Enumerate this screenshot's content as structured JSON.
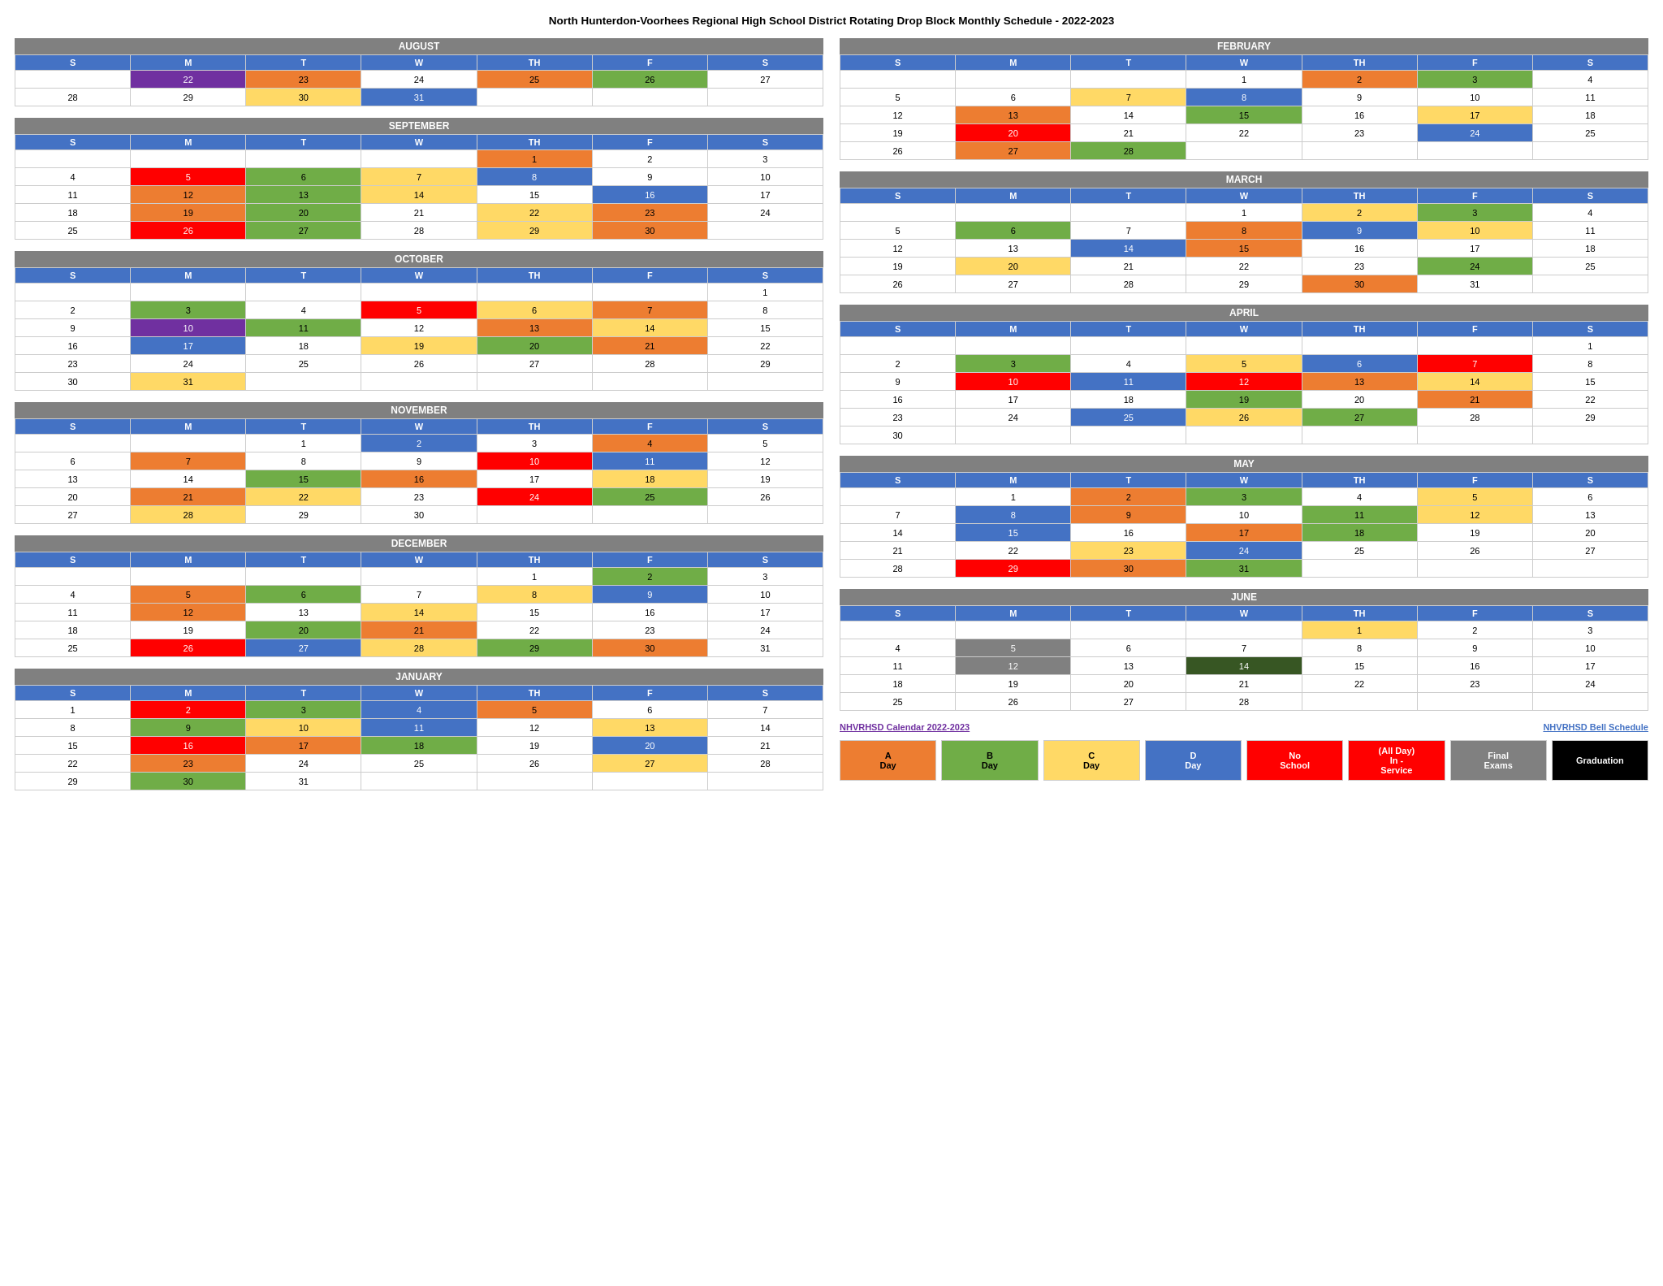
{
  "title": "North Hunterdon-Voorhees Regional High School District Rotating Drop Block Monthly Schedule - 2022-2023",
  "months": {
    "august": {
      "name": "AUGUST",
      "headers": [
        "S",
        "M",
        "T",
        "W",
        "TH",
        "F",
        "S"
      ],
      "rows": [
        [
          "",
          "22",
          "23",
          "24",
          "25",
          "26",
          "27"
        ],
        [
          "28",
          "29",
          "30",
          "31",
          "",
          "",
          ""
        ]
      ],
      "colors": {
        "22": "bg-purple",
        "23": "bg-a",
        "25": "bg-a",
        "26": "bg-b",
        "29": "",
        "30": "bg-c",
        "31": "bg-d"
      }
    },
    "september": {
      "name": "SEPTEMBER",
      "headers": [
        "S",
        "M",
        "T",
        "W",
        "TH",
        "F",
        "S"
      ],
      "rows": [
        [
          "",
          "",
          "",
          "",
          "1",
          "2",
          "3"
        ],
        [
          "4",
          "5",
          "6",
          "7",
          "8",
          "9",
          "10"
        ],
        [
          "11",
          "12",
          "13",
          "14",
          "15",
          "16",
          "17"
        ],
        [
          "18",
          "19",
          "20",
          "21",
          "22",
          "23",
          "24"
        ],
        [
          "25",
          "26",
          "27",
          "28",
          "29",
          "30",
          ""
        ]
      ]
    },
    "october": {
      "name": "OCTOBER",
      "headers": [
        "S",
        "M",
        "T",
        "W",
        "TH",
        "F",
        "S"
      ],
      "rows": [
        [
          "",
          "",
          "",
          "",
          "",
          "",
          "1"
        ],
        [
          "2",
          "3",
          "4",
          "5",
          "6",
          "7",
          "8"
        ],
        [
          "9",
          "10",
          "11",
          "12",
          "13",
          "14",
          "15"
        ],
        [
          "16",
          "17",
          "18",
          "19",
          "20",
          "21",
          "22"
        ],
        [
          "23",
          "24",
          "25",
          "26",
          "27",
          "28",
          "29"
        ],
        [
          "30",
          "31",
          "",
          "",
          "",
          "",
          ""
        ]
      ]
    },
    "november": {
      "name": "NOVEMBER",
      "headers": [
        "S",
        "M",
        "T",
        "W",
        "TH",
        "F",
        "S"
      ],
      "rows": [
        [
          "",
          "",
          "1",
          "2",
          "3",
          "4",
          "5"
        ],
        [
          "6",
          "7",
          "8",
          "9",
          "10",
          "11",
          "12"
        ],
        [
          "13",
          "14",
          "15",
          "16",
          "17",
          "18",
          "19"
        ],
        [
          "20",
          "21",
          "22",
          "23",
          "24",
          "25",
          "26"
        ],
        [
          "27",
          "28",
          "29",
          "30",
          "",
          "",
          ""
        ]
      ]
    },
    "december": {
      "name": "DECEMBER",
      "headers": [
        "S",
        "M",
        "T",
        "W",
        "TH",
        "F",
        "S"
      ],
      "rows": [
        [
          "",
          "",
          "",
          "",
          "1",
          "2",
          "3"
        ],
        [
          "4",
          "5",
          "6",
          "7",
          "8",
          "9",
          "10"
        ],
        [
          "11",
          "12",
          "13",
          "14",
          "15",
          "16",
          "17"
        ],
        [
          "18",
          "19",
          "20",
          "21",
          "22",
          "23",
          "24"
        ],
        [
          "25",
          "26",
          "27",
          "28",
          "29",
          "30",
          "31"
        ]
      ]
    },
    "january": {
      "name": "JANUARY",
      "headers": [
        "S",
        "M",
        "T",
        "W",
        "TH",
        "F",
        "S"
      ],
      "rows": [
        [
          "1",
          "2",
          "3",
          "4",
          "5",
          "6",
          "7"
        ],
        [
          "8",
          "9",
          "10",
          "11",
          "12",
          "13",
          "14"
        ],
        [
          "15",
          "16",
          "17",
          "18",
          "19",
          "20",
          "21"
        ],
        [
          "22",
          "23",
          "24",
          "25",
          "26",
          "27",
          "28"
        ],
        [
          "29",
          "30",
          "31",
          "",
          "",
          "",
          ""
        ]
      ]
    },
    "february": {
      "name": "FEBRUARY",
      "headers": [
        "S",
        "M",
        "T",
        "W",
        "TH",
        "F",
        "S"
      ],
      "rows": [
        [
          "",
          "",
          "",
          "1",
          "2",
          "3",
          "4"
        ],
        [
          "5",
          "6",
          "7",
          "8",
          "9",
          "10",
          "11"
        ],
        [
          "12",
          "13",
          "14",
          "15",
          "16",
          "17",
          "18"
        ],
        [
          "19",
          "20",
          "21",
          "22",
          "23",
          "24",
          "25"
        ],
        [
          "26",
          "27",
          "28",
          "",
          "",
          "",
          ""
        ]
      ]
    },
    "march": {
      "name": "MARCH",
      "headers": [
        "S",
        "M",
        "T",
        "W",
        "TH",
        "F",
        "S"
      ],
      "rows": [
        [
          "",
          "",
          "",
          "1",
          "2",
          "3",
          "4"
        ],
        [
          "5",
          "6",
          "7",
          "8",
          "9",
          "10",
          "11"
        ],
        [
          "12",
          "13",
          "14",
          "15",
          "16",
          "17",
          "18"
        ],
        [
          "19",
          "20",
          "21",
          "22",
          "23",
          "24",
          "25"
        ],
        [
          "26",
          "27",
          "28",
          "29",
          "30",
          "31",
          ""
        ]
      ]
    },
    "april": {
      "name": "APRIL",
      "headers": [
        "S",
        "M",
        "T",
        "W",
        "TH",
        "F",
        "S"
      ],
      "rows": [
        [
          "",
          "",
          "",
          "",
          "",
          "",
          "1"
        ],
        [
          "2",
          "3",
          "4",
          "5",
          "6",
          "7",
          "8"
        ],
        [
          "9",
          "10",
          "11",
          "12",
          "13",
          "14",
          "15"
        ],
        [
          "16",
          "17",
          "18",
          "19",
          "20",
          "21",
          "22"
        ],
        [
          "23",
          "24",
          "25",
          "26",
          "27",
          "28",
          "29"
        ],
        [
          "30",
          "",
          "",
          "",
          "",
          "",
          ""
        ]
      ]
    },
    "may": {
      "name": "MAY",
      "headers": [
        "S",
        "M",
        "T",
        "W",
        "TH",
        "F",
        "S"
      ],
      "rows": [
        [
          "",
          "1",
          "2",
          "3",
          "4",
          "5",
          "6"
        ],
        [
          "7",
          "8",
          "9",
          "10",
          "11",
          "12",
          "13"
        ],
        [
          "14",
          "15",
          "16",
          "17",
          "18",
          "19",
          "20"
        ],
        [
          "21",
          "22",
          "23",
          "24",
          "25",
          "26",
          "27"
        ],
        [
          "28",
          "29",
          "30",
          "31",
          "",
          "",
          ""
        ]
      ]
    },
    "june": {
      "name": "JUNE",
      "headers": [
        "S",
        "M",
        "T",
        "W",
        "TH",
        "F",
        "S"
      ],
      "rows": [
        [
          "",
          "",
          "",
          "",
          "1",
          "2",
          "3"
        ],
        [
          "4",
          "5",
          "6",
          "7",
          "8",
          "9",
          "10"
        ],
        [
          "11",
          "12",
          "13",
          "14",
          "15",
          "16",
          "17"
        ],
        [
          "18",
          "19",
          "20",
          "21",
          "22",
          "23",
          "24"
        ],
        [
          "25",
          "26",
          "27",
          "28",
          "",
          "",
          ""
        ]
      ]
    }
  },
  "links": {
    "calendar": "NHVRHSD Calendar 2022-2023",
    "bell": "NHVRHSD Bell Schedule"
  },
  "legend": {
    "a": "A\nDay",
    "b": "B\nDay",
    "c": "C\nDay",
    "d": "D\nDay",
    "noschool": "No\nSchool",
    "inservice": "(All Day)\nIn -\nService",
    "finals": "Final\nExams",
    "graduation": "Graduation"
  }
}
